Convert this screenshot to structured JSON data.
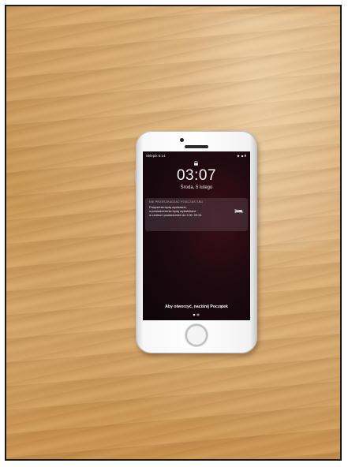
{
  "lock_screen": {
    "carrier": "Sklepik 5:14",
    "status_icons": "⬥ ◼▮",
    "time": "03:07",
    "date": "Środa, 5 lutego",
    "notification": {
      "header": "NIE PRZESZKADZAĆ PODCZAS SNU",
      "body_lines": [
        "Połączenia będą wyciszane,",
        "a powiadomienia będą wyświetlane",
        "w centrum powiadomień do 1:00, 09:10."
      ],
      "icon": "bed-icon"
    },
    "unlock_hint": "Aby otworzyć, naciśnij Początek",
    "page_dots": 2
  },
  "colors": {
    "wood": "#cf9f63",
    "phone_body": "#f7f7f7",
    "screen_bg": "#1e0a10"
  }
}
